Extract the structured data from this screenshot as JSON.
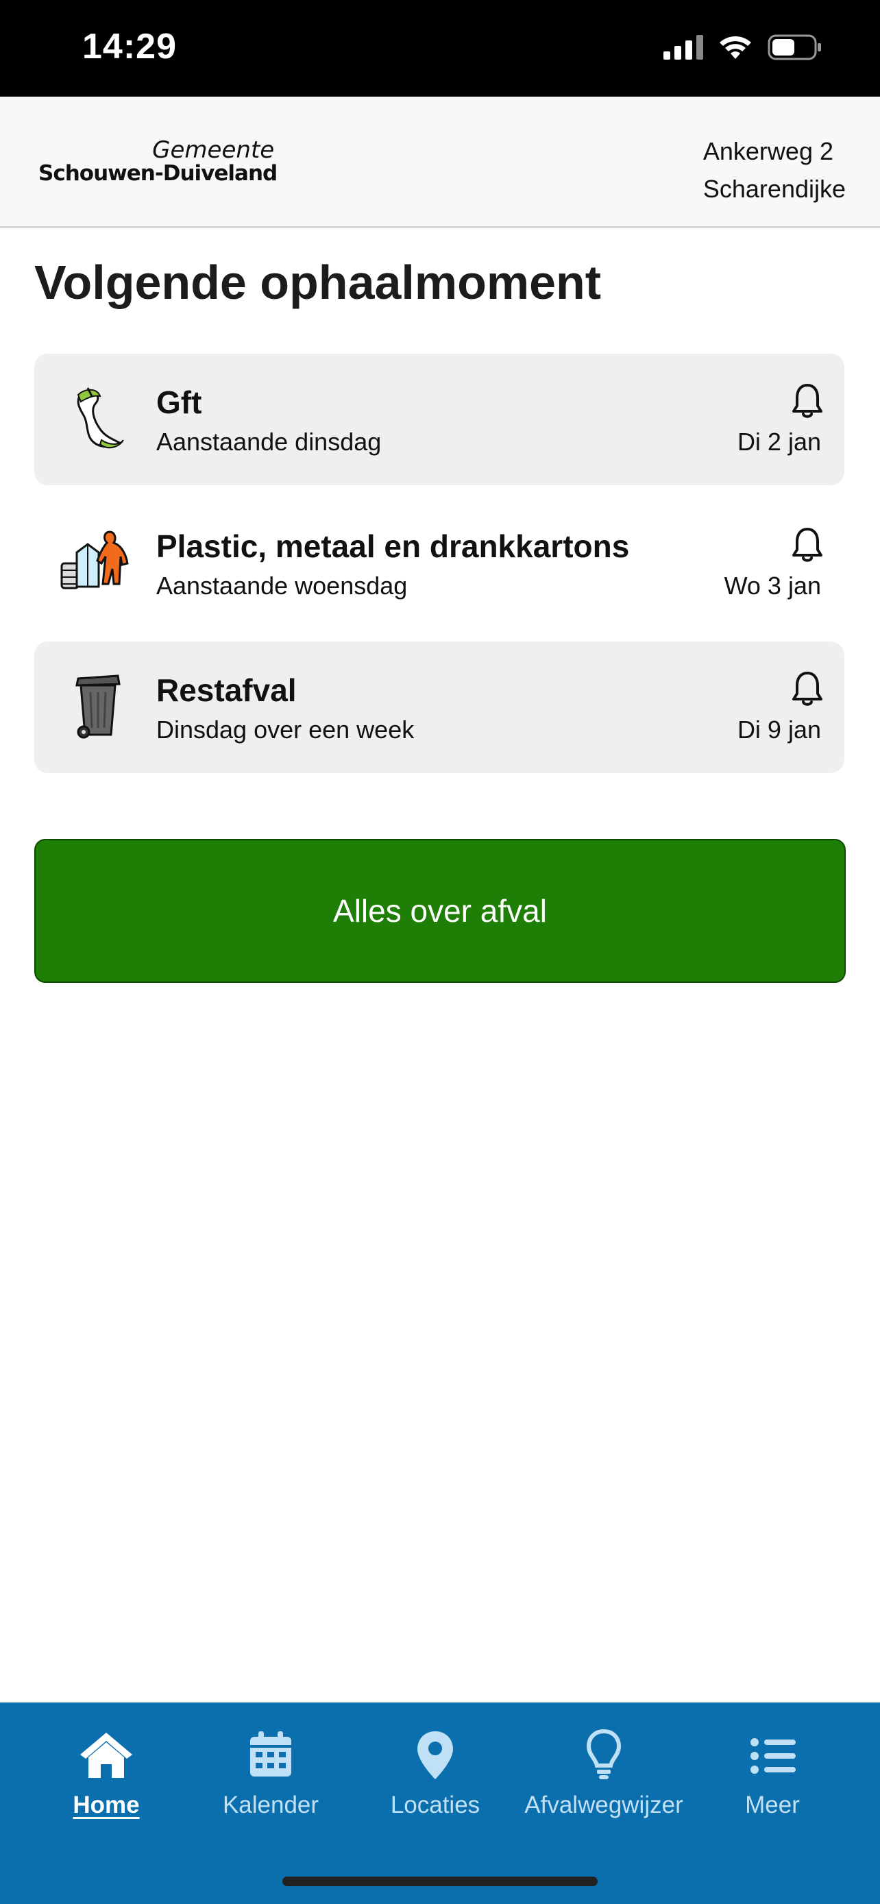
{
  "status_bar": {
    "time": "14:29",
    "battery_level": 0.55
  },
  "header": {
    "logo_top": "Gemeente",
    "logo_bottom": "Schouwen-Duiveland",
    "address_line1": "Ankerweg 2",
    "address_line2": "Scharendijke"
  },
  "main": {
    "title": "Volgende ophaalmoment",
    "cards": [
      {
        "title": "Gft",
        "subtitle": "Aanstaande dinsdag",
        "date": "Di 2 jan",
        "icon": "apple-core-icon"
      },
      {
        "title": "Plastic, metaal en drankkartons",
        "subtitle": "Aanstaande woensdag",
        "date": "Wo 3 jan",
        "icon": "pmd-icon"
      },
      {
        "title": "Restafval",
        "subtitle": "Dinsdag over een week",
        "date": "Di 9 jan",
        "icon": "wheelie-bin-icon"
      }
    ],
    "cta_label": "Alles over afval"
  },
  "tabbar": {
    "items": [
      {
        "label": "Home",
        "icon": "home-icon",
        "active": true
      },
      {
        "label": "Kalender",
        "icon": "calendar-icon",
        "active": false
      },
      {
        "label": "Locaties",
        "icon": "location-pin-icon",
        "active": false
      },
      {
        "label": "Afvalwegwijzer",
        "icon": "lightbulb-icon",
        "active": false
      },
      {
        "label": "Meer",
        "icon": "list-icon",
        "active": false
      }
    ]
  },
  "colors": {
    "accent_green": "#1e7e06",
    "tabbar_blue": "#0b6fae",
    "card_gray": "#efefef"
  }
}
